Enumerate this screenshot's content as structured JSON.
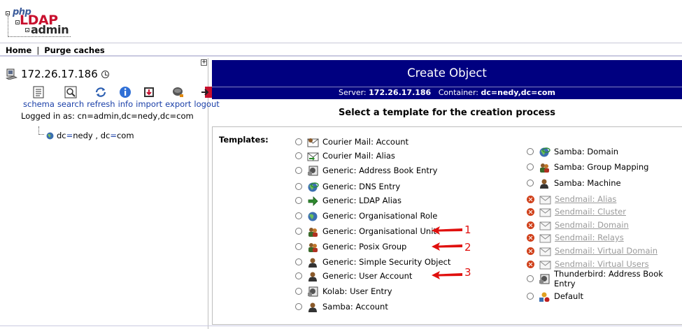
{
  "logo": {
    "php": "php",
    "ldap": "LDAP",
    "admin": "admin"
  },
  "topbar": {
    "home": "Home",
    "separator": "|",
    "purge": "Purge caches"
  },
  "left": {
    "expand_glyph": "+",
    "server": "172.26.17.186",
    "tools": [
      {
        "label": "schema",
        "icon": "schema-icon"
      },
      {
        "label": "search",
        "icon": "search-icon"
      },
      {
        "label": "refresh",
        "icon": "refresh-icon"
      },
      {
        "label": "info",
        "icon": "info-icon"
      },
      {
        "label": "import",
        "icon": "import-icon"
      },
      {
        "label": "export",
        "icon": "export-icon"
      },
      {
        "label": "logout",
        "icon": "logout-icon"
      }
    ],
    "logged_in": "Logged in as: cn=admin,dc=nedy,dc=com",
    "tree": {
      "a1": "dc",
      "eq1": "=",
      "v1": "nedy",
      "sep": " , ",
      "a2": "dc",
      "eq2": "=",
      "v2": "com"
    }
  },
  "main": {
    "title": "Create Object",
    "server_label": "Server:",
    "server_value": "172.26.17.186",
    "container_label": "Container:",
    "container_value": "dc=nedy,dc=com",
    "select_title": "Select a template for the creation process",
    "templates_label": "Templates:",
    "left_templates": [
      {
        "label": "Courier Mail: Account",
        "icon": "mail-user-icon"
      },
      {
        "label": "Courier Mail: Alias",
        "icon": "mail-alias-icon"
      },
      {
        "label": "Generic: Address Book Entry",
        "icon": "address-book-icon"
      },
      {
        "label": "Generic: DNS Entry",
        "icon": "dns-icon"
      },
      {
        "label": "Generic: LDAP Alias",
        "icon": "alias-arrow-icon"
      },
      {
        "label": "Generic: Organisational Role",
        "icon": "globe-icon"
      },
      {
        "label": "Generic: Organisational Unit",
        "icon": "group-icon"
      },
      {
        "label": "Generic: Posix Group",
        "icon": "group-icon"
      },
      {
        "label": "Generic: Simple Security Object",
        "icon": "user-icon"
      },
      {
        "label": "Generic: User Account",
        "icon": "user-icon"
      },
      {
        "label": "Kolab: User Entry",
        "icon": "address-book-icon"
      },
      {
        "label": "Samba: Account",
        "icon": "user-icon"
      }
    ],
    "right_templates": [
      {
        "label": "Samba: Domain",
        "icon": "dns-icon",
        "enabled": true
      },
      {
        "label": "Samba: Group Mapping",
        "icon": "group-icon",
        "enabled": true
      },
      {
        "label": "Samba: Machine",
        "icon": "user-icon",
        "enabled": true
      },
      {
        "label": "Sendmail: Alias",
        "icon": "mail-icon",
        "enabled": false
      },
      {
        "label": "Sendmail: Cluster",
        "icon": "mail-icon",
        "enabled": false
      },
      {
        "label": "Sendmail: Domain",
        "icon": "mail-icon",
        "enabled": false
      },
      {
        "label": "Sendmail: Relays",
        "icon": "mail-icon",
        "enabled": false
      },
      {
        "label": "Sendmail: Virtual Domain",
        "icon": "mail-icon",
        "enabled": false
      },
      {
        "label": "Sendmail: Virtual Users",
        "icon": "mail-icon",
        "enabled": false
      },
      {
        "label": "Thunderbird: Address Book Entry",
        "icon": "address-book-icon",
        "enabled": true
      },
      {
        "label": "Default",
        "icon": "default-objects-icon",
        "enabled": true
      }
    ],
    "annotations": [
      "1",
      "2",
      "3"
    ]
  },
  "colors": {
    "header_bg": "#000080",
    "link": "#1a3fa8",
    "annotation": "#e0100e",
    "disabled": "#9a9a9a"
  }
}
